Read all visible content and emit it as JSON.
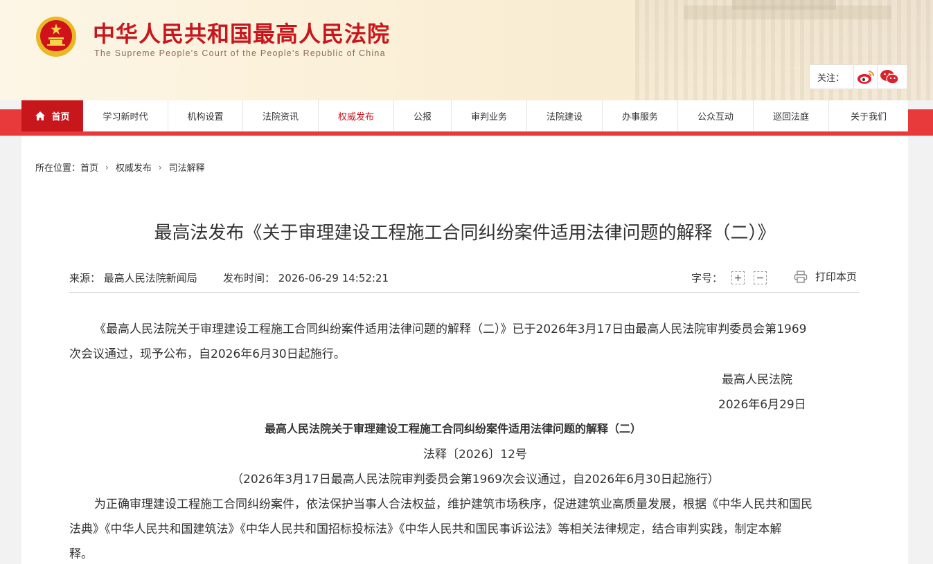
{
  "header": {
    "title": "中华人民共和国最高人民法院",
    "subtitle": "The Supreme People's Court of the People's Republic of China",
    "follow_label": "关注：",
    "social": [
      "weibo-icon",
      "wechat-icon"
    ]
  },
  "nav": {
    "home": "首页",
    "items": [
      "学习新时代",
      "机构设置",
      "法院资讯",
      "权威发布",
      "公报",
      "审判业务",
      "法院建设",
      "办事服务",
      "公众互动",
      "巡回法庭",
      "关于我们"
    ],
    "active": "权威发布"
  },
  "breadcrumb": {
    "label": "所在位置：",
    "items": [
      "首页",
      "权威发布",
      "司法解释"
    ]
  },
  "article": {
    "title": "最高法发布《关于审理建设工程施工合同纠纷案件适用法律问题的解释（二）》",
    "source": "来源：  最高人民法院新闻局",
    "publish_time": "发布时间：  2026-06-29 14:52:21",
    "font_size_label": "字号：",
    "print_label": "打印本页",
    "para1_line1": "《最高人民法院关于审理建设工程施工合同纠纷案件适用法律问题的解释（二）》已于2026年3月17日由最高人民法院审判委员会第1969",
    "para1_line2": "次会议通过，现予公布，自2026年6月30日起施行。",
    "sign_org": "最高人民法院",
    "sign_date": "2026年6月29日",
    "doc_title": "最高人民法院关于审理建设工程施工合同纠纷案件适用法律问题的解释（二）",
    "doc_number": "法释〔2026〕12号",
    "doc_note": "（2026年3月17日最高人民法院审判委员会第1969次会议通过，自2026年6月30日起施行）",
    "para2_line1": "为正确审理建设工程施工合同纠纷案件，依法保护当事人合法权益，维护建筑市场秩序，促进建筑业高质量发展，根据《中华人民共和国民",
    "para2_line2": "法典》《中华人民共和国建筑法》《中华人民共和国招标投标法》《中华人民共和国民事诉讼法》等相关法律规定，结合审判实践，制定本解",
    "para2_line3": "释。"
  },
  "colors": {
    "brand_red": "#c8161d",
    "nav_band": "#e83a3a"
  }
}
